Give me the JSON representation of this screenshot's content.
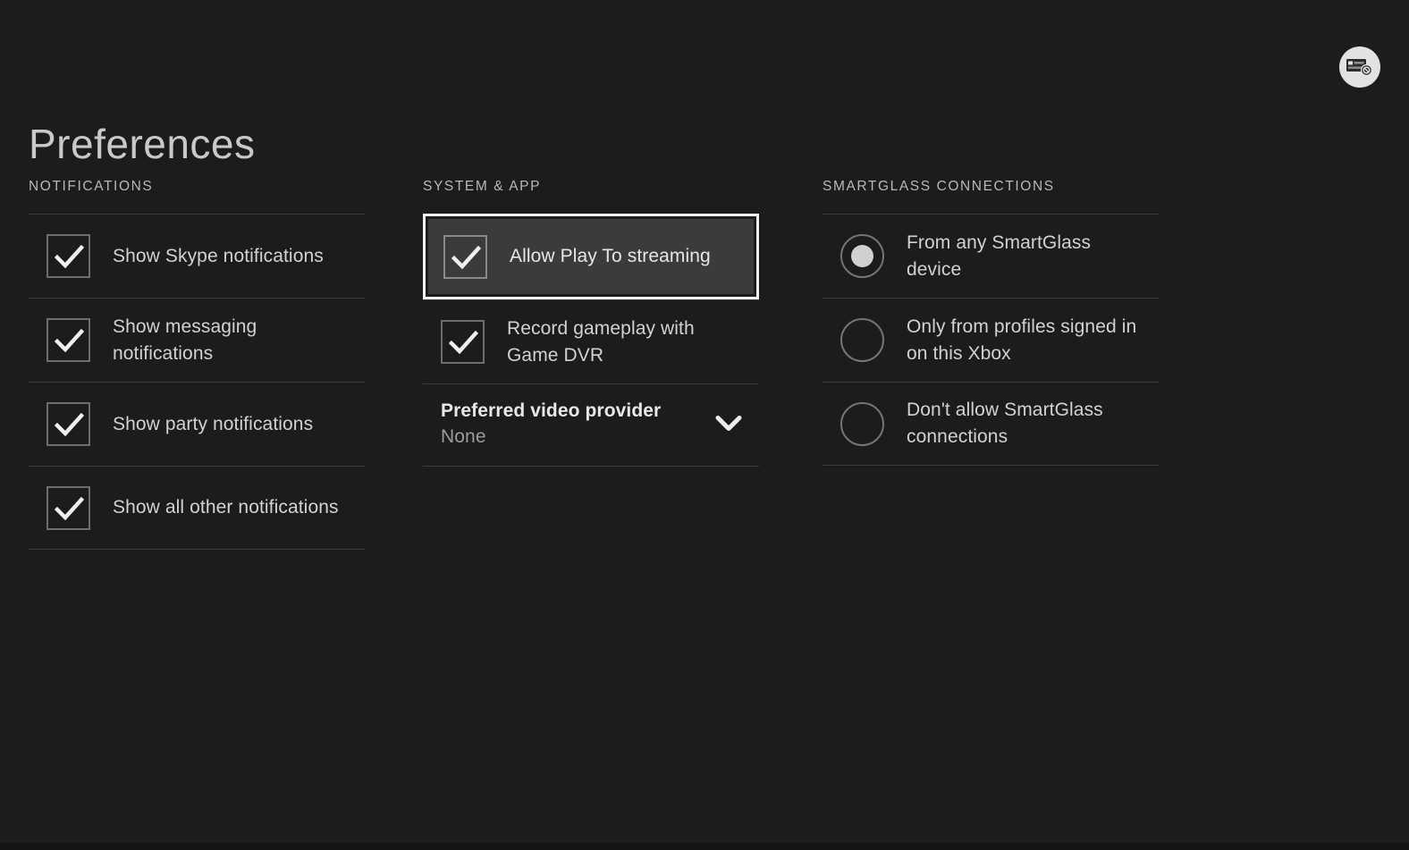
{
  "page": {
    "title": "Preferences",
    "background_color": "#1c1c1c",
    "text_color": "#d2d2d2",
    "focus_outline_color": "#f2f2f2"
  },
  "status_icon": {
    "name": "card-blocked-icon",
    "label": "No payment instrument"
  },
  "columns": [
    {
      "key": "notifications",
      "header": "NOTIFICATIONS",
      "items": [
        {
          "type": "checkbox",
          "label": "Show Skype notifications",
          "checked": true
        },
        {
          "type": "checkbox",
          "label": "Show messaging notifications",
          "checked": true
        },
        {
          "type": "checkbox",
          "label": "Show party notifications",
          "checked": true
        },
        {
          "type": "checkbox",
          "label": "Show all other notifications",
          "checked": true
        }
      ]
    },
    {
      "key": "system_app",
      "header": "SYSTEM & APP",
      "items": [
        {
          "type": "checkbox",
          "label": "Allow Play To streaming",
          "checked": true,
          "focused": true
        },
        {
          "type": "checkbox",
          "label": "Record gameplay with Game DVR",
          "checked": true
        },
        {
          "type": "dropdown",
          "label": "Preferred video provider",
          "value": "None"
        }
      ]
    },
    {
      "key": "smartglass_connections",
      "header": "SMARTGLASS CONNECTIONS",
      "items": [
        {
          "type": "radio",
          "label": "From any SmartGlass device",
          "checked": true
        },
        {
          "type": "radio",
          "label": "Only from profiles signed in on this Xbox",
          "checked": false
        },
        {
          "type": "radio",
          "label": "Don't allow SmartGlass connections",
          "checked": false
        }
      ]
    }
  ]
}
